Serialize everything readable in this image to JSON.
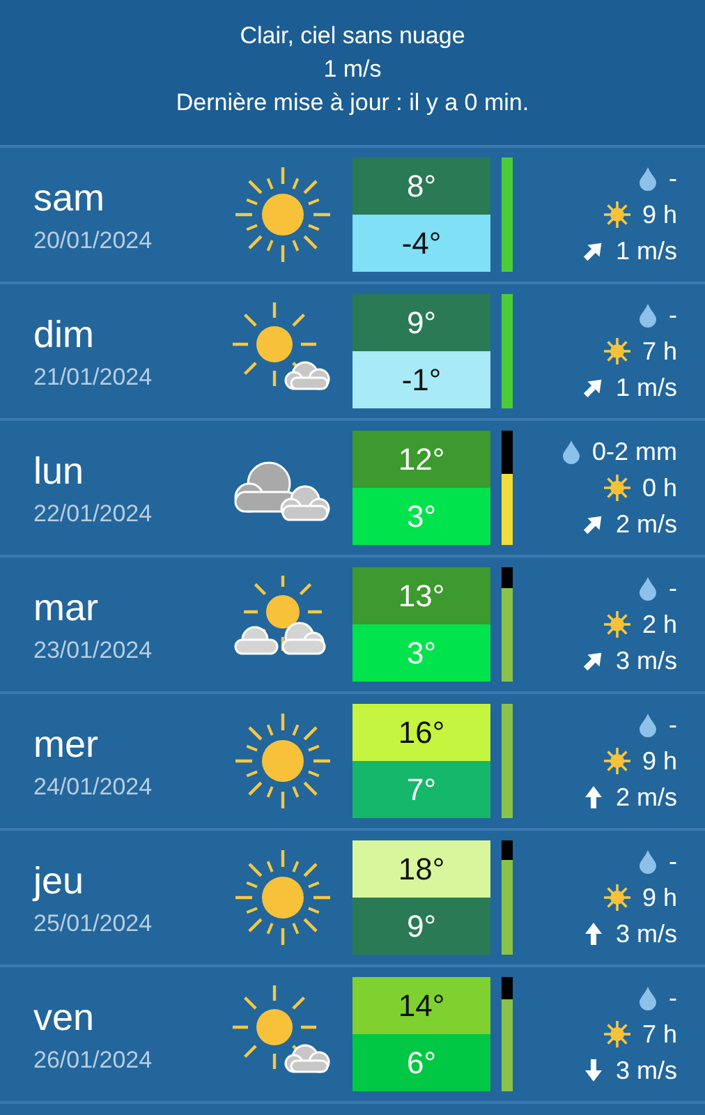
{
  "header": {
    "lines": [
      "Clair, ciel sans nuage",
      "1 m/s",
      "Dernière mise à jour : il y a 0 min."
    ]
  },
  "days": [
    {
      "day": "sam",
      "date": "20/01/2024",
      "weather": {
        "kind": "sun"
      },
      "high": {
        "text": "8°",
        "color": "#2a7a55"
      },
      "low": {
        "text": "-4°",
        "color": "#7fe0f6"
      },
      "bar": {
        "level": 1,
        "color": "#4ccd38"
      },
      "rain": "-",
      "sun": "9 h",
      "wind": {
        "text": "1 m/s",
        "kind": "ne"
      }
    },
    {
      "day": "dim",
      "date": "21/01/2024",
      "weather": {
        "kind": "sun-cloud"
      },
      "high": {
        "text": "9°",
        "color": "#2a7a55"
      },
      "low": {
        "text": "-1°",
        "color": "#a8ebf7"
      },
      "bar": {
        "level": 1,
        "color": "#4ccd38"
      },
      "rain": "-",
      "sun": "7 h",
      "wind": {
        "text": "1 m/s",
        "kind": "ne"
      }
    },
    {
      "day": "lun",
      "date": "22/01/2024",
      "weather": {
        "kind": "cloud"
      },
      "high": {
        "text": "12°",
        "color": "#3c9a2e"
      },
      "low": {
        "text": "3°",
        "color": "#00e34c"
      },
      "bar": {
        "level": 0.62,
        "color": "#f2dd3a"
      },
      "rain": "0-2 mm",
      "sun": "0 h",
      "wind": {
        "text": "2 m/s",
        "kind": "ne"
      }
    },
    {
      "day": "mar",
      "date": "23/01/2024",
      "weather": {
        "kind": "sun-clouds"
      },
      "high": {
        "text": "13°",
        "color": "#3c9a2e"
      },
      "low": {
        "text": "3°",
        "color": "#00e34c"
      },
      "bar": {
        "level": 0.82,
        "color": "#8bc34a"
      },
      "rain": "-",
      "sun": "2 h",
      "wind": {
        "text": "3 m/s",
        "kind": "ne"
      }
    },
    {
      "day": "mer",
      "date": "24/01/2024",
      "weather": {
        "kind": "sun"
      },
      "high": {
        "text": "16°",
        "color": "#c6f53f"
      },
      "low": {
        "text": "7°",
        "color": "#15b86a"
      },
      "bar": {
        "level": 1,
        "color": "#8bc34a"
      },
      "rain": "-",
      "sun": "9 h",
      "wind": {
        "text": "2 m/s",
        "kind": "n"
      }
    },
    {
      "day": "jeu",
      "date": "25/01/2024",
      "weather": {
        "kind": "sun"
      },
      "high": {
        "text": "18°",
        "color": "#d8f79c"
      },
      "low": {
        "text": "9°",
        "color": "#2a7a55"
      },
      "bar": {
        "level": 0.83,
        "color": "#8bc34a"
      },
      "rain": "-",
      "sun": "9 h",
      "wind": {
        "text": "3 m/s",
        "kind": "n"
      }
    },
    {
      "day": "ven",
      "date": "26/01/2024",
      "weather": {
        "kind": "sun-cloud"
      },
      "high": {
        "text": "14°",
        "color": "#7ed12e"
      },
      "low": {
        "text": "6°",
        "color": "#00c844"
      },
      "bar": {
        "level": 0.8,
        "color": "#8bc34a"
      },
      "rain": "-",
      "sun": "7 h",
      "wind": {
        "text": "3 m/s",
        "kind": "s"
      }
    }
  ]
}
